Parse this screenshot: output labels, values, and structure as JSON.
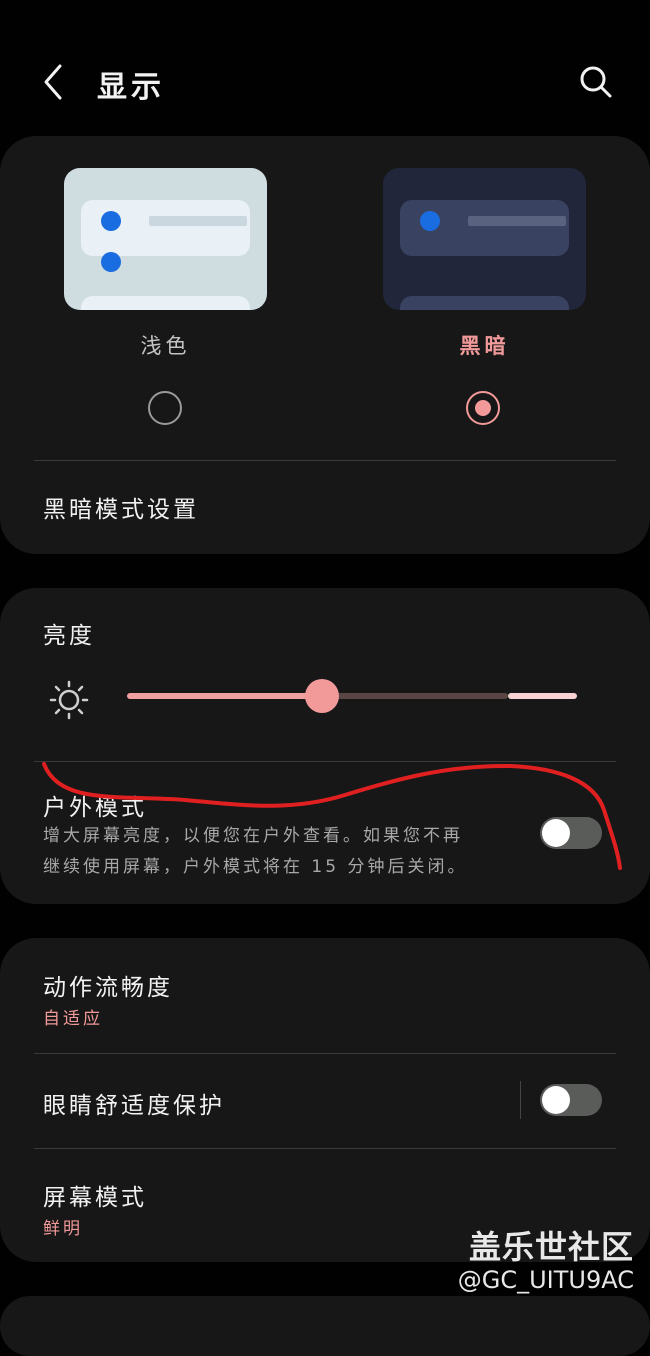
{
  "header": {
    "title": "显示",
    "back_icon": "chevron-left-icon",
    "search_icon": "search-icon"
  },
  "theme": {
    "light_label": "浅色",
    "dark_label": "黑暗",
    "selected": "dark",
    "accent_color": "#f29a9a",
    "settings_label": "黑暗模式设置"
  },
  "brightness": {
    "title": "亮度",
    "level": 0.43,
    "icon": "sun-icon",
    "outdoor_title": "户外模式",
    "outdoor_desc_1": "增大屏幕亮度，以便您在户外查看。如果您不再",
    "outdoor_desc_2": "继续使用屏幕，户外模式将在 15 分钟后关闭。",
    "outdoor_enabled": false
  },
  "display": {
    "motion_title": "动作流畅度",
    "motion_value": "自适应",
    "eye_title": "眼睛舒适度保护",
    "eye_enabled": false,
    "screen_mode_title": "屏幕模式",
    "screen_mode_value": "鲜明"
  },
  "watermark": {
    "line1": "盖乐世社区",
    "line2": "@GC_UITU9AC"
  }
}
